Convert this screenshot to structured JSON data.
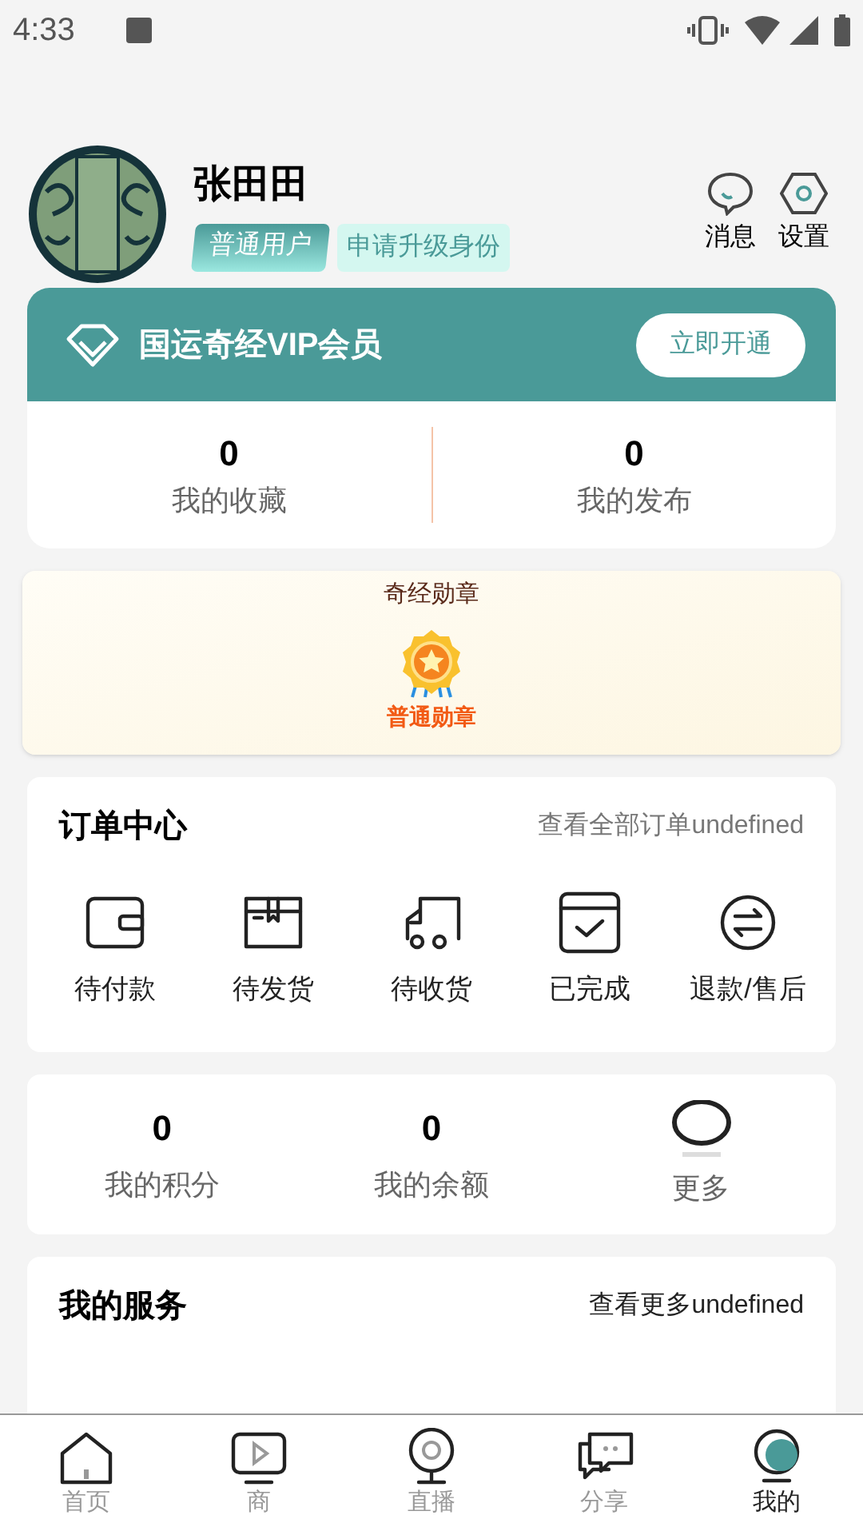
{
  "status_bar": {
    "time": "4:33"
  },
  "profile": {
    "name": "张田田",
    "role_badge": "普通用户",
    "upgrade_badge": "申请升级身份"
  },
  "header_actions": [
    {
      "kind": "message",
      "label": "消息"
    },
    {
      "kind": "settings",
      "label": "设置"
    }
  ],
  "vip": {
    "title": "国运奇经VIP会员",
    "button": "立即开通"
  },
  "vip_stats": [
    {
      "value": "0",
      "label": "我的收藏"
    },
    {
      "value": "0",
      "label": "我的发布"
    }
  ],
  "medals": {
    "title": "奇经勋章",
    "medal": "普通勋章"
  },
  "orders": {
    "title": "订单中心",
    "link": "查看全部订单undefined",
    "items": [
      {
        "kind": "wallet",
        "label": "待付款"
      },
      {
        "kind": "box",
        "label": "待发货"
      },
      {
        "kind": "truck",
        "label": "待收货"
      },
      {
        "kind": "done",
        "label": "已完成"
      },
      {
        "kind": "refund",
        "label": "退款/售后"
      }
    ]
  },
  "wallet_stats": [
    {
      "kind": "number",
      "value": "0",
      "label": "我的积分"
    },
    {
      "kind": "number",
      "value": "0",
      "label": "我的余额"
    },
    {
      "kind": "more",
      "label": "更多"
    }
  ],
  "services": {
    "title": "我的服务",
    "link": "查看更多undefined"
  },
  "tab_bar": [
    {
      "kind": "home",
      "label": "首页",
      "selected": false
    },
    {
      "kind": "video",
      "label": "商",
      "selected": false
    },
    {
      "kind": "live",
      "label": "直播",
      "selected": false
    },
    {
      "kind": "chat",
      "label": "分享",
      "selected": false
    },
    {
      "kind": "me",
      "label": "我的",
      "selected": true
    }
  ]
}
